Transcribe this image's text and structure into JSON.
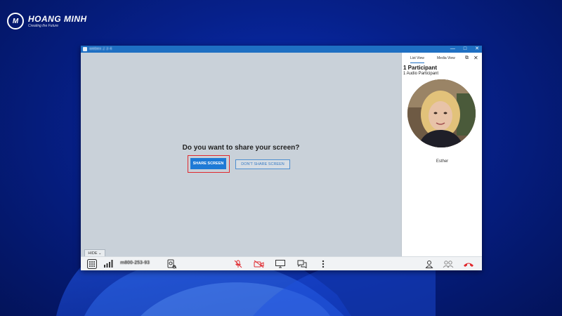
{
  "brand": {
    "name": "HOANG MINH",
    "tagline": "Creating the Future"
  },
  "window": {
    "title": "webex 2 3 4"
  },
  "share_dialog": {
    "question": "Do you want to share your screen?",
    "share_label": "SHARE SCREEN",
    "dont_share_label": "DON'T SHARE SCREEN"
  },
  "hide_tab": {
    "label": "HIDE"
  },
  "side_panel": {
    "tab_list": "List View",
    "tab_media": "Media View",
    "participants_title": "1 Participant",
    "participants_sub": "1 Audio Participant",
    "avatar_name": "Esther"
  },
  "bottom_bar": {
    "meeting_number": "m800-253-93",
    "icons": [
      "keypad-icon",
      "signal-icon",
      "audio-device-icon",
      "mute-mic-icon",
      "video-off-icon",
      "share-screen-icon",
      "chat-icon",
      "more-icon",
      "participant-icon",
      "participants-icon",
      "hangup-icon"
    ],
    "mute_color": "#e0292e",
    "hangup_color": "#e0292e"
  }
}
